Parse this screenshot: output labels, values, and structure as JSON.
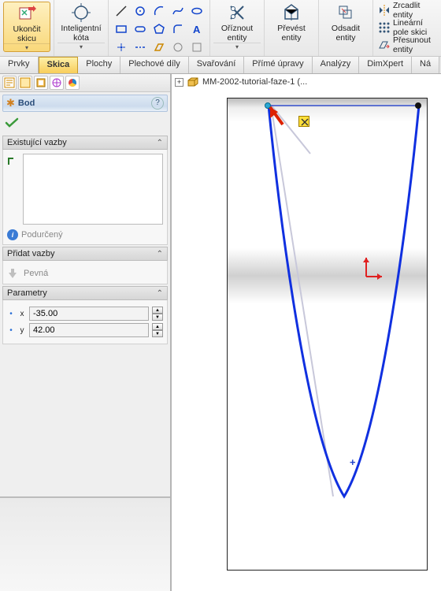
{
  "ribbon": {
    "exit_sketch": "Ukončit\nskicu",
    "smart_dim": "Inteligentní\nkóta",
    "trim": "Oříznout\nentity",
    "convert": "Převést\nentity",
    "offset": "Odsadit\nentity",
    "mirror": "Zrcadlit entity",
    "linear_pattern": "Lineární pole skici",
    "move": "Přesunout entity"
  },
  "tabs": [
    "Prvky",
    "Skica",
    "Plochy",
    "Plechové díly",
    "Svařování",
    "Přímé úpravy",
    "Analýzy",
    "DimXpert",
    "Ná"
  ],
  "active_tab": 1,
  "crumb": "MM-2002-tutorial-faze-1  (...",
  "pm": {
    "feature_title": "Bod",
    "sect_relations": "Existující vazby",
    "status": "Podurčený",
    "sect_add": "Přidat vazby",
    "add_fixed": "Pevná",
    "sect_params": "Parametry",
    "x_label": "x",
    "y_label": "y",
    "x_value": "-35.00",
    "y_value": "42.00"
  }
}
